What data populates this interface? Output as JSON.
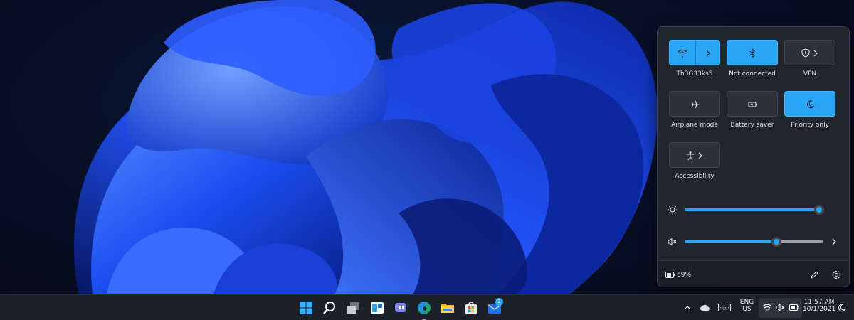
{
  "quick_settings": {
    "tiles": [
      {
        "label": "Th3G33ks5",
        "icon": "wifi-icon",
        "state": "on",
        "has_arrow": true
      },
      {
        "label": "Not connected",
        "icon": "bluetooth-icon",
        "state": "on",
        "has_arrow": false
      },
      {
        "label": "VPN",
        "icon": "shield-icon",
        "state": "off",
        "has_arrow": true
      },
      {
        "label": "Airplane mode",
        "icon": "airplane-icon",
        "state": "off",
        "has_arrow": false
      },
      {
        "label": "Battery saver",
        "icon": "battery-saver-icon",
        "state": "off",
        "has_arrow": false
      },
      {
        "label": "Priority only",
        "icon": "moon-icon",
        "state": "on",
        "has_arrow": false
      },
      {
        "label": "Accessibility",
        "icon": "accessibility-icon",
        "state": "off",
        "has_arrow": true
      }
    ],
    "brightness_level": 1.0,
    "volume_level": 0.66,
    "volume_muted": true,
    "battery_text": "69%"
  },
  "taskbar": {
    "apps": [
      "windows-start-icon",
      "search-icon",
      "task-view-icon",
      "widgets-icon",
      "chat-icon",
      "edge-icon",
      "file-explorer-icon",
      "store-icon",
      "mail-icon"
    ],
    "mail_badge": "2",
    "language_line1": "ENG",
    "language_line2": "US",
    "time": "11:57 AM",
    "date": "10/1/2021"
  },
  "colors": {
    "accent": "#2aa4f4",
    "panel_bg": "#202630",
    "taskbar_bg": "#1c2028"
  }
}
